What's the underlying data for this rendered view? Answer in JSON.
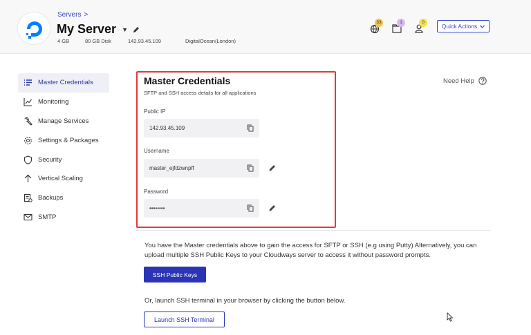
{
  "header": {
    "breadcrumb": "Servers",
    "breadcrumb_chevron": ">",
    "server_name": "My Server",
    "meta": {
      "ram": "4 GB",
      "disk": "80 GB Disk",
      "ip": "142.93.45.109",
      "provider": "DigitalOcean(London)"
    },
    "badges": {
      "notifications": "33",
      "projects": "1",
      "users": "0"
    },
    "quick_actions_label": "Quick Actions"
  },
  "sidebar": {
    "items": [
      {
        "label": "Master Credentials",
        "icon": "list-icon",
        "active": true
      },
      {
        "label": "Monitoring",
        "icon": "chart-line-icon"
      },
      {
        "label": "Manage Services",
        "icon": "wrench-icon"
      },
      {
        "label": "Settings & Packages",
        "icon": "gear-icon"
      },
      {
        "label": "Security",
        "icon": "shield-icon"
      },
      {
        "label": "Vertical Scaling",
        "icon": "arrow-up-icon"
      },
      {
        "label": "Backups",
        "icon": "backup-icon"
      },
      {
        "label": "SMTP",
        "icon": "mail-icon"
      }
    ]
  },
  "main": {
    "title": "Master Credentials",
    "subtitle": "SFTP and SSH access details for all applications",
    "need_help": "Need Help",
    "fields": {
      "public_ip": {
        "label": "Public IP",
        "value": "142.93.45.109"
      },
      "username": {
        "label": "Username",
        "value": "master_ejfdzwnpff"
      },
      "password": {
        "label": "Password",
        "value": "••••••••"
      }
    },
    "info_text": "You have the Master credentials above to gain the access for SFTP or SSH (e.g using Putty) Alternatively, you can upload multiple SSH Public Keys to your Cloudways server to access it without password prompts.",
    "ssh_keys_button": "SSH Public Keys",
    "terminal_text": "Or, launch SSH terminal in your browser by clicking the button below.",
    "launch_button": "Launch SSH Terminal"
  },
  "colors": {
    "accent": "#2a34b5",
    "highlight_border": "#e0383b",
    "badge_orange": "#f5c24a",
    "badge_purple": "#d7b8f0",
    "badge_yellow": "#f5e04a"
  }
}
